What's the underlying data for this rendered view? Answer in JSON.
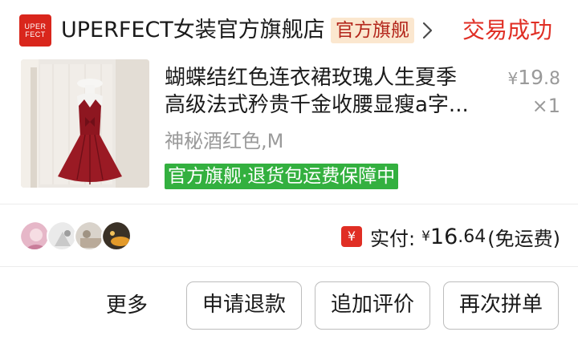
{
  "header": {
    "logo_line1": "UPER",
    "logo_line2": "FECT",
    "store_name": "UPERFECT女装官方旗舰店",
    "store_badge": "官方旗舰",
    "order_status": "交易成功"
  },
  "product": {
    "title_line1": "蝴蝶结红色连衣裙玫瑰人生夏季",
    "title_line2": "高级法式矜贵千金收腰显瘦a字...",
    "price_symbol": "¥",
    "price_int": "19",
    "price_dec": ".8",
    "quantity": "×1",
    "spec": "神秘酒红色,M",
    "promo_tag": "官方旗舰·退货包运费保障中"
  },
  "payment": {
    "icon_symbol": "¥",
    "label": "实付:",
    "symbol": "¥",
    "amount_int": "16",
    "amount_dec": ".64",
    "note": "(免运费)"
  },
  "group_avatars": [
    "avatar-1",
    "avatar-2",
    "avatar-3",
    "avatar-4"
  ],
  "actions": {
    "more": "更多",
    "refund": "申请退款",
    "review": "追加评价",
    "regroup": "再次拼单"
  },
  "colors": {
    "brand_red": "#e02e24",
    "badge_bg": "#fbe7cf",
    "promo_green": "#33b03f",
    "muted_text": "#9a9a9a"
  }
}
